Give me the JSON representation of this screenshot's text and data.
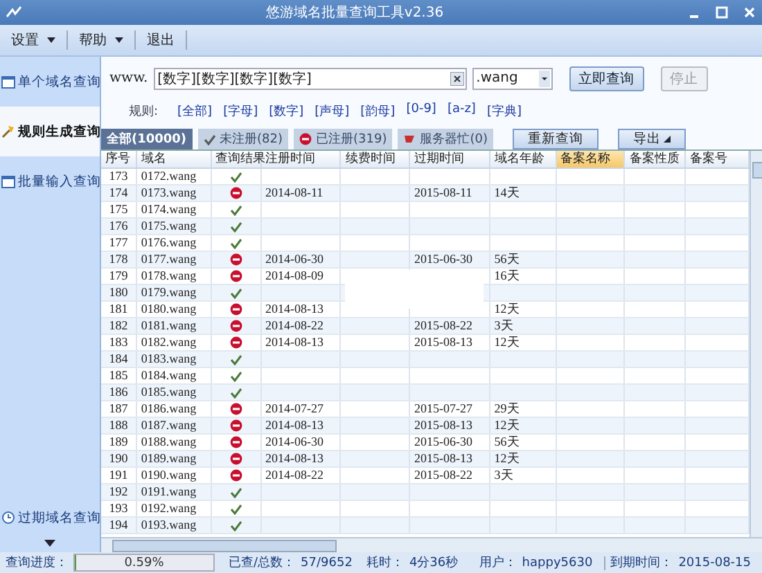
{
  "window": {
    "title": "悠游域名批量查询工具v2.36"
  },
  "menu": [
    {
      "label": "设置",
      "dropdown": true
    },
    {
      "label": "帮助",
      "dropdown": true
    },
    {
      "label": "退出",
      "dropdown": false
    }
  ],
  "sidebar": {
    "items": [
      {
        "label": "单个域名查询",
        "selected": false
      },
      {
        "label": "规则生成查询",
        "selected": true
      },
      {
        "label": "批量输入查询",
        "selected": false
      }
    ],
    "bottom_item": {
      "label": "过期域名查询"
    }
  },
  "query": {
    "prefix": "www.",
    "pattern": "[数字][数字][数字][数字]",
    "suffix": ".wang",
    "query_button": "立即查询",
    "stop_button": {
      "label": "停止",
      "disabled": true
    }
  },
  "rules": {
    "label": "规则:",
    "items": [
      "[全部]",
      "[字母]",
      "[数字]",
      "[声母]",
      "[韵母]",
      "[0-9]",
      "[a-z]",
      "[字典]"
    ]
  },
  "filters": [
    {
      "label": "全部(10000)",
      "selected": true
    },
    {
      "label": "未注册(82)",
      "selected": false
    },
    {
      "label": "已注册(319)",
      "selected": false
    },
    {
      "label": "服务器忙(0)",
      "selected": false
    }
  ],
  "actions": [
    {
      "label": "重新查询",
      "menu": false
    },
    {
      "label": "导出",
      "menu": true
    }
  ],
  "table": {
    "columns": [
      {
        "label": "序号",
        "highlighted": false
      },
      {
        "label": "域名",
        "highlighted": false
      },
      {
        "label": "查询结果",
        "highlighted": false
      },
      {
        "label": "注册时间",
        "highlighted": false
      },
      {
        "label": "续费时间",
        "highlighted": false
      },
      {
        "label": "过期时间",
        "highlighted": false
      },
      {
        "label": "域名年龄",
        "highlighted": false
      },
      {
        "label": "备案名称",
        "highlighted": true
      },
      {
        "label": "备案性质",
        "highlighted": false
      },
      {
        "label": "备案号",
        "highlighted": false
      }
    ],
    "rows": [
      {
        "no": "173",
        "domain": "0172.wang",
        "kind": "available"
      },
      {
        "no": "174",
        "domain": "0173.wang",
        "kind": "registered",
        "registered": "2014-08-11",
        "expires": "2015-08-11",
        "age": "14天"
      },
      {
        "no": "175",
        "domain": "0174.wang",
        "kind": "available"
      },
      {
        "no": "176",
        "domain": "0175.wang",
        "kind": "available"
      },
      {
        "no": "177",
        "domain": "0176.wang",
        "kind": "available"
      },
      {
        "no": "178",
        "domain": "0177.wang",
        "kind": "registered",
        "registered": "2014-06-30",
        "expires": "2015-06-30",
        "age": "56天"
      },
      {
        "no": "179",
        "domain": "0178.wang",
        "kind": "registered",
        "registered": "2014-08-09",
        "age": "16天"
      },
      {
        "no": "180",
        "domain": "0179.wang",
        "kind": "available"
      },
      {
        "no": "181",
        "domain": "0180.wang",
        "kind": "registered",
        "registered": "2014-08-13",
        "age": "12天"
      },
      {
        "no": "182",
        "domain": "0181.wang",
        "kind": "registered",
        "registered": "2014-08-22",
        "expires": "2015-08-22",
        "age": "3天"
      },
      {
        "no": "183",
        "domain": "0182.wang",
        "kind": "registered",
        "registered": "2014-08-13",
        "expires": "2015-08-13",
        "age": "12天"
      },
      {
        "no": "184",
        "domain": "0183.wang",
        "kind": "available"
      },
      {
        "no": "185",
        "domain": "0184.wang",
        "kind": "available"
      },
      {
        "no": "186",
        "domain": "0185.wang",
        "kind": "available"
      },
      {
        "no": "187",
        "domain": "0186.wang",
        "kind": "registered",
        "registered": "2014-07-27",
        "expires": "2015-07-27",
        "age": "29天"
      },
      {
        "no": "188",
        "domain": "0187.wang",
        "kind": "registered",
        "registered": "2014-08-13",
        "expires": "2015-08-13",
        "age": "12天"
      },
      {
        "no": "189",
        "domain": "0188.wang",
        "kind": "registered",
        "registered": "2014-06-30",
        "expires": "2015-06-30",
        "age": "56天"
      },
      {
        "no": "190",
        "domain": "0189.wang",
        "kind": "registered",
        "registered": "2014-08-13",
        "expires": "2015-08-13",
        "age": "12天"
      },
      {
        "no": "191",
        "domain": "0190.wang",
        "kind": "registered",
        "registered": "2014-08-22",
        "expires": "2015-08-22",
        "age": "3天"
      },
      {
        "no": "192",
        "domain": "0191.wang",
        "kind": "available"
      },
      {
        "no": "193",
        "domain": "0192.wang",
        "kind": "available"
      },
      {
        "no": "194",
        "domain": "0193.wang",
        "kind": "available"
      }
    ]
  },
  "status_bar": {
    "progress_label": "查询进度：",
    "progress": {
      "level": 0.0059,
      "text": "0.59%"
    },
    "count_label": "已查/总数：",
    "count": "57/9652",
    "time_label": "耗时：",
    "time": "4分36秒",
    "user_label": "用户：",
    "user": "happy5630",
    "expiry_label": "到期时间：",
    "expiry": "2015-08-15"
  }
}
